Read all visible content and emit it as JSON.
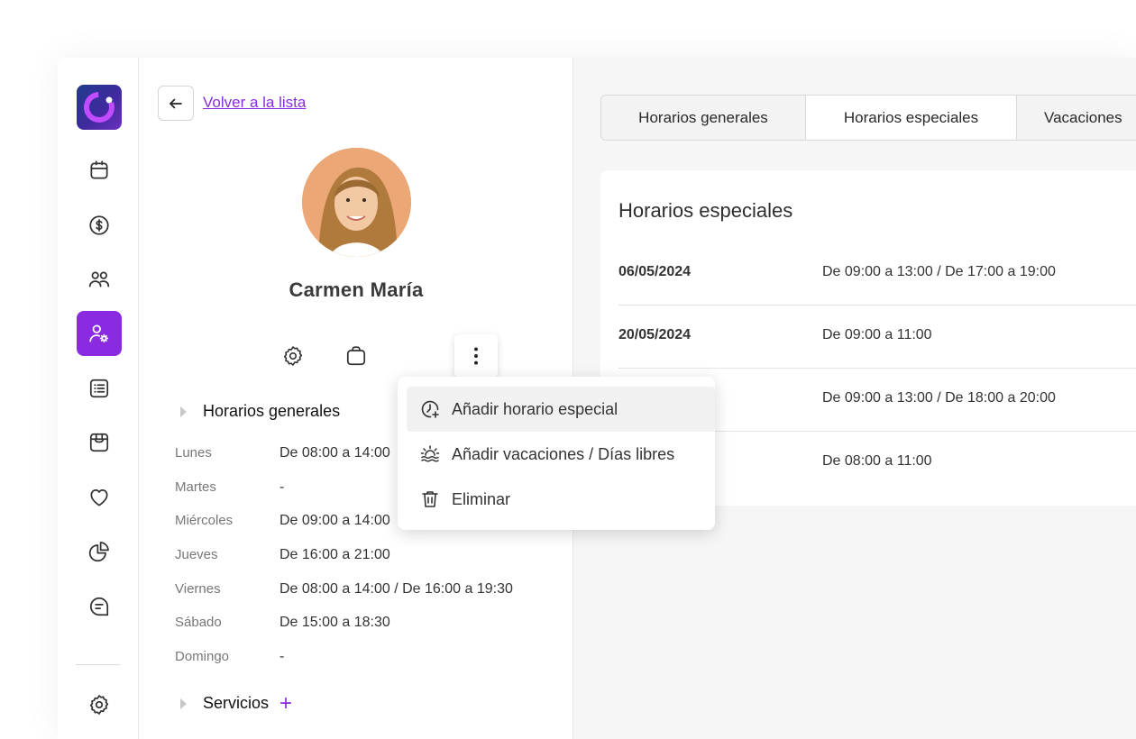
{
  "back": {
    "label": "Volver a la lista"
  },
  "profile": {
    "name": "Carmen María"
  },
  "general": {
    "title": "Horarios generales",
    "days": [
      {
        "day": "Lunes",
        "time": "De 08:00 a 14:00"
      },
      {
        "day": "Martes",
        "time": "-"
      },
      {
        "day": "Miércoles",
        "time": "De 09:00 a 14:00"
      },
      {
        "day": "Jueves",
        "time": "De 16:00 a 21:00"
      },
      {
        "day": "Viernes",
        "time": "De 08:00 a 14:00 / De 16:00 a 19:30"
      },
      {
        "day": "Sábado",
        "time": "De 15:00 a 18:30"
      },
      {
        "day": "Domingo",
        "time": "-"
      }
    ]
  },
  "services": {
    "title": "Servicios",
    "add_symbol": "+"
  },
  "tabs": [
    {
      "label": "Horarios generales",
      "active": false
    },
    {
      "label": "Horarios especiales",
      "active": true
    },
    {
      "label": "Vacaciones",
      "active": false
    }
  ],
  "special": {
    "title": "Horarios especiales",
    "rows": [
      {
        "date": "06/05/2024",
        "time": "De 09:00 a 13:00 / De 17:00 a 19:00"
      },
      {
        "date": "20/05/2024",
        "time": "De 09:00 a 11:00"
      },
      {
        "date": "",
        "time": "De 09:00 a 13:00 / De 18:00 a 20:00"
      },
      {
        "date": "",
        "time": "De 08:00 a 11:00"
      }
    ]
  },
  "menu": {
    "items": [
      {
        "label": "Añadir horario especial",
        "icon": "clock-plus-icon"
      },
      {
        "label": "Añadir vacaciones / Días libres",
        "icon": "sunset-icon"
      },
      {
        "label": "Eliminar",
        "icon": "trash-icon"
      }
    ]
  },
  "colors": {
    "accent": "#8a2be2",
    "panel_bg": "#f6f6f6"
  },
  "sidebar_icons": [
    "calendar-icon",
    "dollar-icon",
    "users-icon",
    "user-settings-icon",
    "list-icon",
    "store-icon",
    "heart-icon",
    "pie-chart-icon",
    "message-icon",
    "settings-icon"
  ]
}
